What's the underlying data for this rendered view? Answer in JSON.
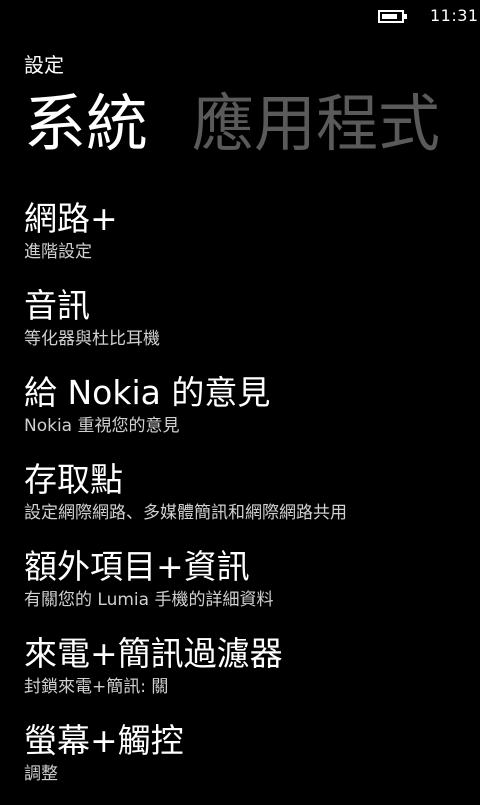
{
  "status_bar": {
    "time": "11:31",
    "battery_level": 0.85
  },
  "app_title": "設定",
  "pivot": {
    "headers": [
      {
        "label": "系統",
        "active": true
      },
      {
        "label": "應用程式",
        "active": false
      }
    ]
  },
  "settings": {
    "items": [
      {
        "title": "網路+",
        "subtitle": "進階設定"
      },
      {
        "title": "音訊",
        "subtitle": "等化器與杜比耳機"
      },
      {
        "title": "給 Nokia 的意見",
        "subtitle": "Nokia 重視您的意見"
      },
      {
        "title": "存取點",
        "subtitle": "設定網際網路、多媒體簡訊和網際網路共用"
      },
      {
        "title": "額外項目+資訊",
        "subtitle": "有關您的 Lumia 手機的詳細資料"
      },
      {
        "title": "來電+簡訊過濾器",
        "subtitle": "封鎖來電+簡訊: 關"
      },
      {
        "title": "螢幕+觸控",
        "subtitle": "調整"
      }
    ]
  }
}
